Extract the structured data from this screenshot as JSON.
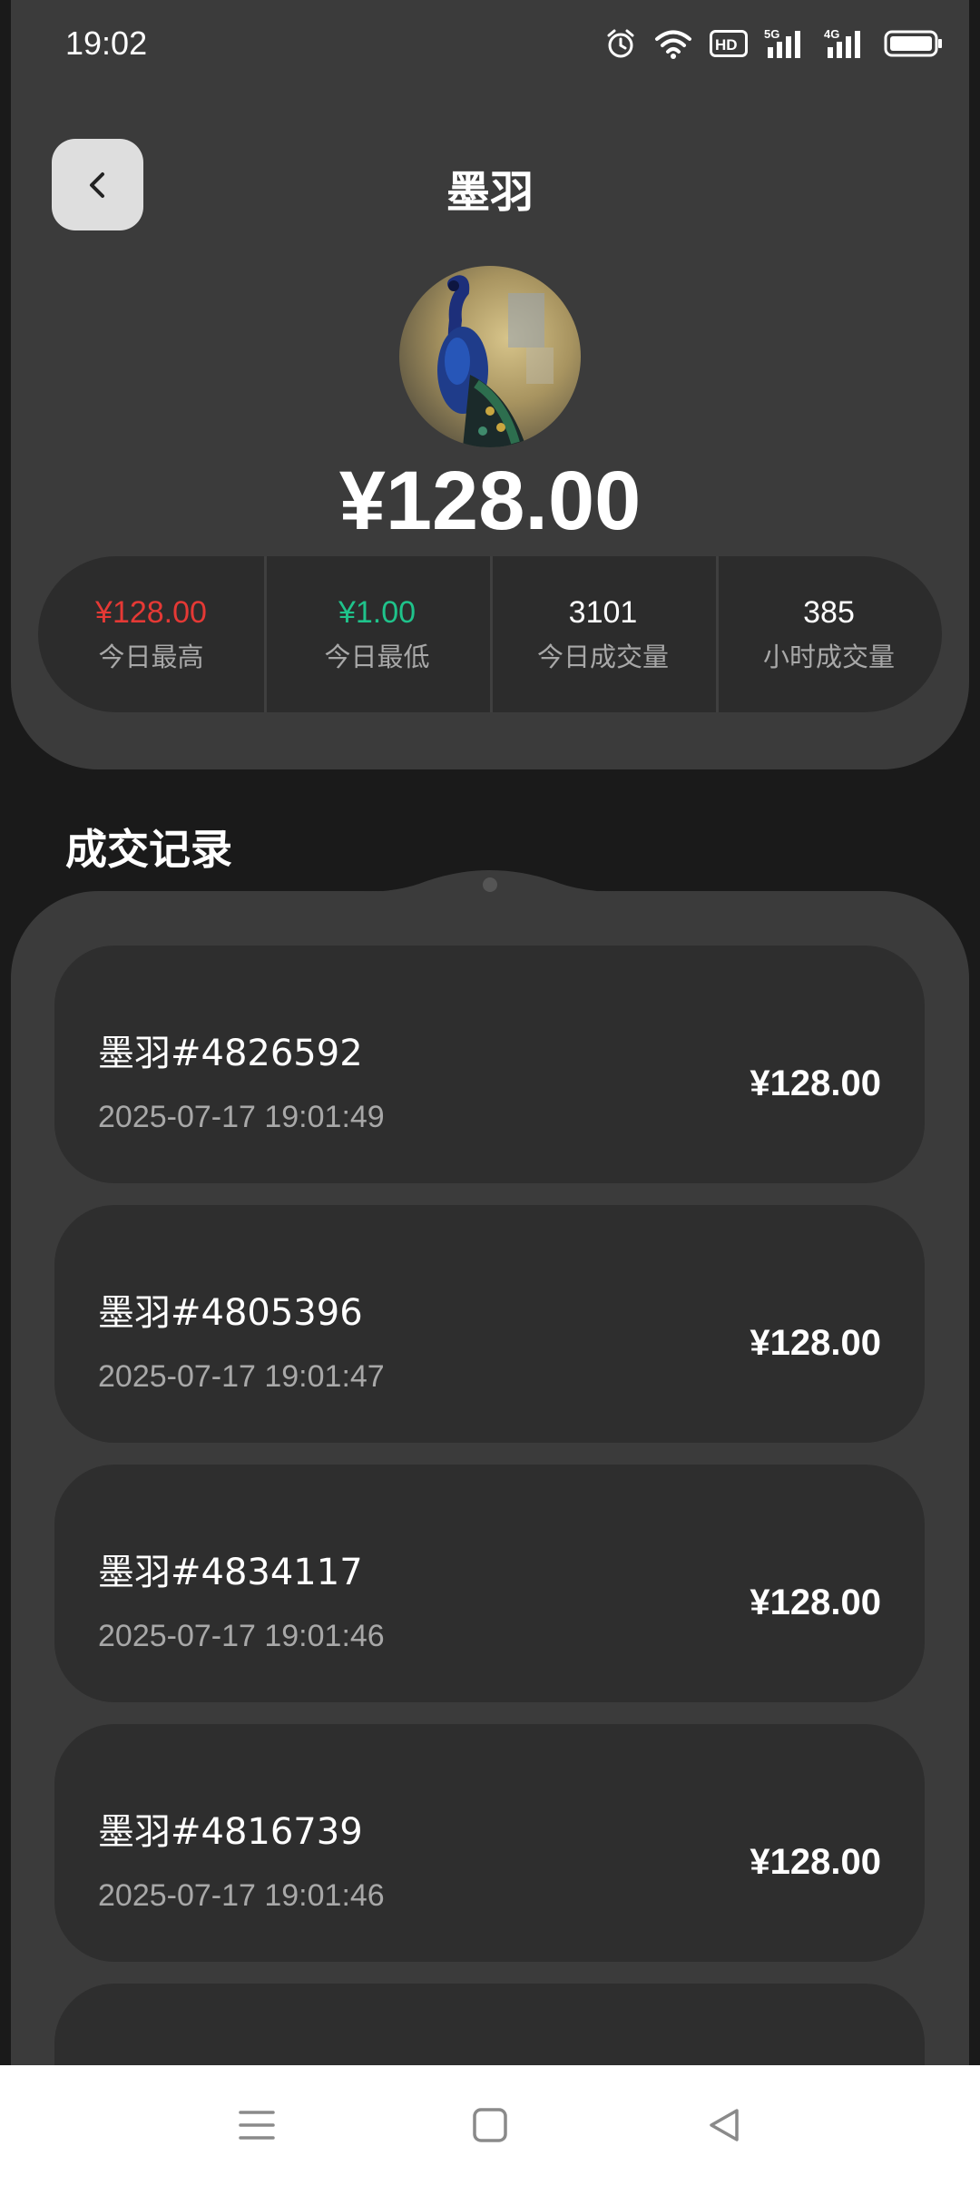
{
  "status_bar": {
    "time": "19:02",
    "icons": [
      "alarm-icon",
      "wifi-icon",
      "hd-icon",
      "5g-signal-icon",
      "4g-signal-icon",
      "battery-icon"
    ],
    "hd_label": "HD",
    "sig1_label": "5G",
    "sig2_label": "4G"
  },
  "header": {
    "title": "墨羽",
    "price": "¥128.00"
  },
  "stats": [
    {
      "value": "¥128.00",
      "label": "今日最高",
      "color": "#e53935"
    },
    {
      "value": "¥1.00",
      "label": "今日最低",
      "color": "#1fc38b"
    },
    {
      "value": "3101",
      "label": "今日成交量",
      "color": "#ffffff"
    },
    {
      "value": "385",
      "label": "小时成交量",
      "color": "#ffffff"
    }
  ],
  "section_title": "成交记录",
  "records": [
    {
      "name": "墨羽#4826592",
      "time": "2025-07-17 19:01:49",
      "price": "¥128.00"
    },
    {
      "name": "墨羽#4805396",
      "time": "2025-07-17 19:01:47",
      "price": "¥128.00"
    },
    {
      "name": "墨羽#4834117",
      "time": "2025-07-17 19:01:46",
      "price": "¥128.00"
    },
    {
      "name": "墨羽#4816739",
      "time": "2025-07-17 19:01:46",
      "price": "¥128.00"
    },
    {
      "name": "",
      "time": "",
      "price": ""
    }
  ],
  "nav": [
    "menu-icon",
    "home-icon",
    "back-triangle-icon"
  ]
}
